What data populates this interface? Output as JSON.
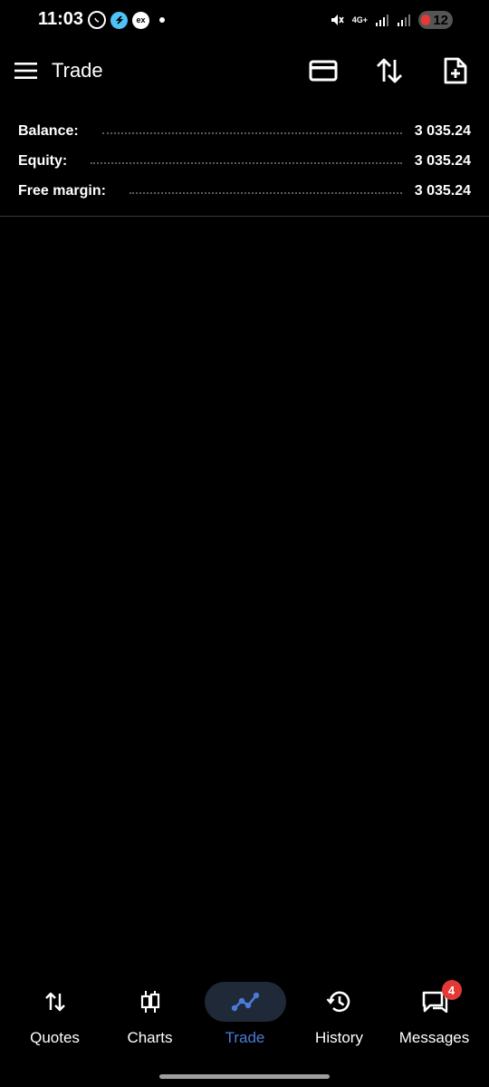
{
  "status_bar": {
    "time": "11:03",
    "network": "4G+",
    "battery_level": "12",
    "app_icons": [
      "whatsapp-icon",
      "skype-icon",
      "ex-icon"
    ],
    "ex_label": "ex"
  },
  "app_bar": {
    "title": "Trade",
    "icons": [
      "menu-icon",
      "credit-card-icon",
      "sort-icon",
      "new-document-icon"
    ]
  },
  "account": {
    "rows": [
      {
        "label": "Balance:",
        "value": "3 035.24"
      },
      {
        "label": "Equity:",
        "value": "3 035.24"
      },
      {
        "label": "Free margin:",
        "value": "3 035.24"
      }
    ]
  },
  "bottom_nav": {
    "items": [
      {
        "label": "Quotes",
        "icon": "quotes-icon"
      },
      {
        "label": "Charts",
        "icon": "charts-icon"
      },
      {
        "label": "Trade",
        "icon": "trade-icon",
        "active": true
      },
      {
        "label": "History",
        "icon": "history-icon"
      },
      {
        "label": "Messages",
        "icon": "messages-icon",
        "badge": "4"
      }
    ]
  },
  "colors": {
    "background": "#000000",
    "accent": "#4a7bd8",
    "badge": "#e53935",
    "active_pill": "#1f2937"
  }
}
